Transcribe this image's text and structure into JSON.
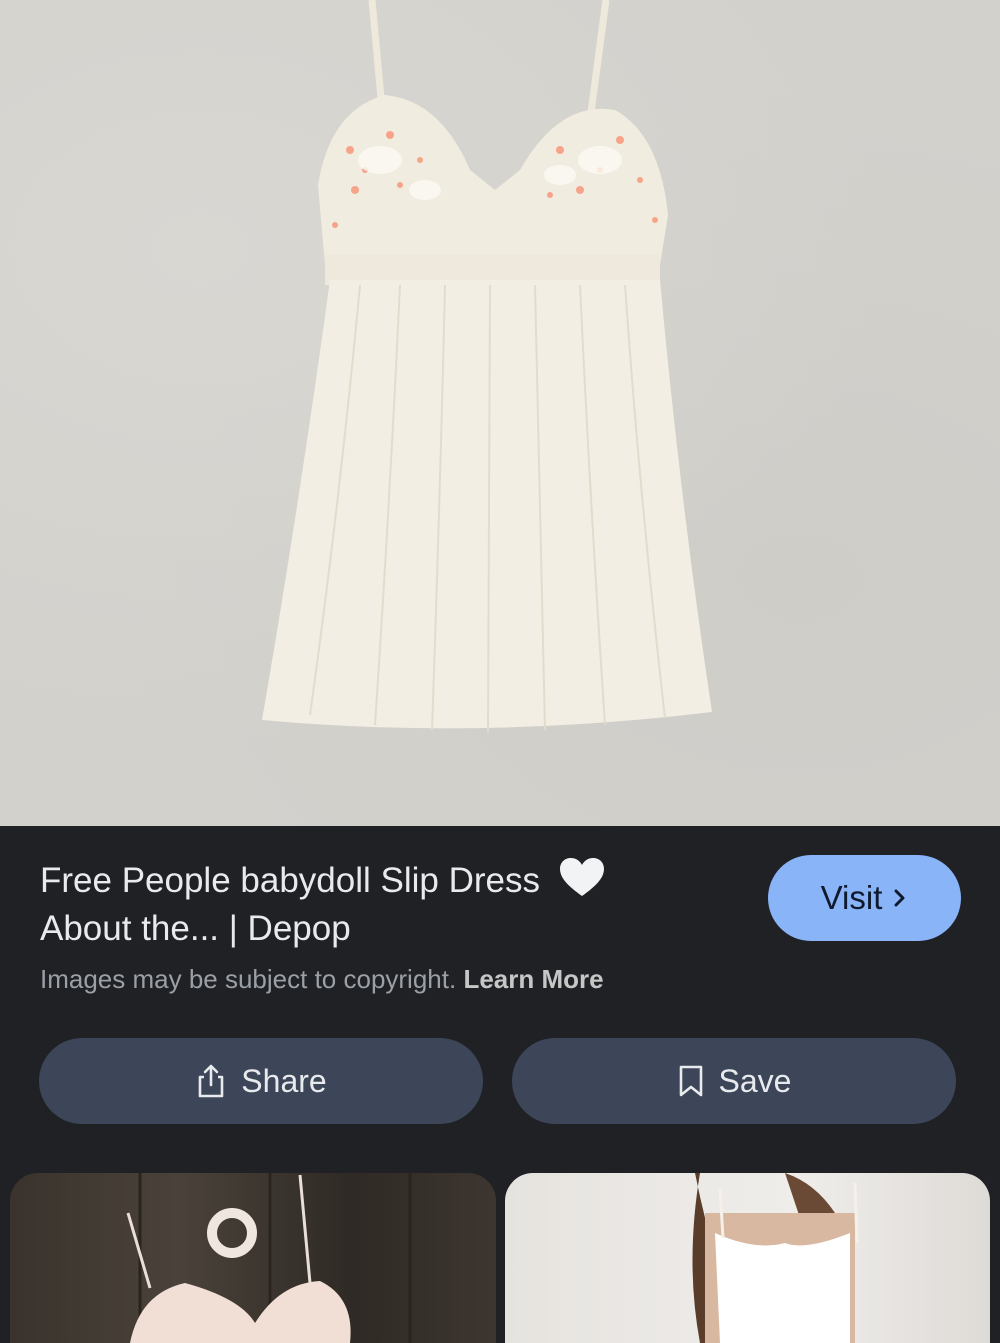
{
  "result": {
    "title_line1": "Free People babydoll Slip Dress",
    "title_line2": "About the... | Depop",
    "heart_emoji": "white-heart-icon"
  },
  "visit_button": {
    "label": "Visit",
    "icon": "chevron-right-icon"
  },
  "copyright": {
    "text": "Images may be subject to copyright.",
    "link_label": "Learn More"
  },
  "actions": {
    "share_label": "Share",
    "share_icon": "share-icon",
    "save_label": "Save",
    "save_icon": "bookmark-icon"
  },
  "colors": {
    "panel_bg": "#1f2125",
    "visit_bg": "#8ab4f8",
    "action_bg": "#3c4658",
    "text": "#e8eaed",
    "muted": "#9aa0a6"
  }
}
